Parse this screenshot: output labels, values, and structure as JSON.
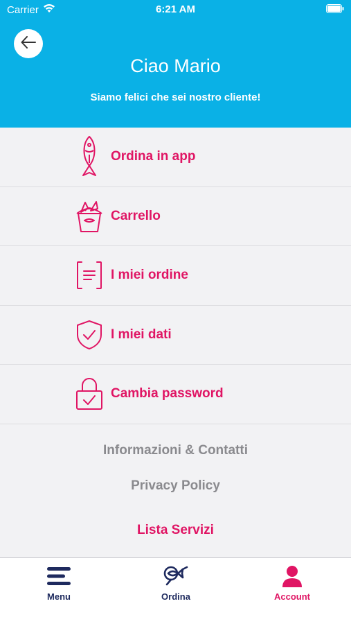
{
  "status_bar": {
    "carrier": "Carrier",
    "time": "6:21 AM"
  },
  "header": {
    "greeting": "Ciao Mario",
    "subtitle": "Siamo felici che sei nostro cliente!"
  },
  "menu": {
    "items": [
      {
        "label": "Ordina in app",
        "icon": "fish-icon"
      },
      {
        "label": "Carrello",
        "icon": "fish-bucket-icon"
      },
      {
        "label": "I miei ordine",
        "icon": "document-icon"
      },
      {
        "label": "I miei dati",
        "icon": "shield-check-icon"
      },
      {
        "label": "Cambia password",
        "icon": "lock-check-icon"
      }
    ]
  },
  "links": {
    "info": "Informazioni & Contatti",
    "privacy": "Privacy Policy",
    "services": "Lista Servizi"
  },
  "tabbar": {
    "tabs": [
      {
        "label": "Menu",
        "icon": "hamburger-icon"
      },
      {
        "label": "Ordina",
        "icon": "fish-search-icon"
      },
      {
        "label": "Account",
        "icon": "person-icon",
        "active": true
      }
    ]
  },
  "colors": {
    "header": "#0ab1e6",
    "accent": "#e01564",
    "tab_inactive": "#1e2a5e",
    "link_grey": "#8a8a8e"
  }
}
